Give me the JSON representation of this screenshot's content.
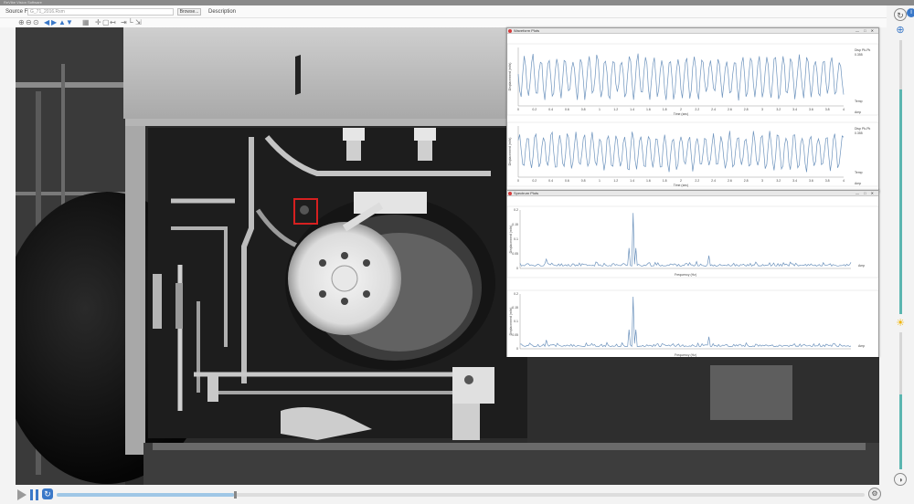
{
  "window": {
    "title": "ReVibe Vision Software"
  },
  "header": {
    "source_label": "Source File",
    "source_value": "G_71_2016.Rsm",
    "browse_label": "Browse...",
    "description_label": "Description"
  },
  "toolbar": {
    "icons": [
      "zoom-in-icon",
      "zoom-out-icon",
      "zoom-fit-icon",
      "arrow-left-icon",
      "arrow-right-icon",
      "arrow-up-icon",
      "arrow-down-icon",
      "grid-icon",
      "crosshair-icon",
      "roi-icon",
      "measure-icon",
      "marker-icon",
      "axes-icon",
      "export-icon"
    ]
  },
  "windows": [
    {
      "title": "Waveform Plots",
      "kind": "waveform"
    },
    {
      "title": "Spectrum Plots",
      "kind": "spectrum"
    }
  ],
  "plots": {
    "waveform": {
      "xlabel": "Time (sec)",
      "ylabel": "Displacement (mils)",
      "side_readout": [
        "Disp Pk-Pk",
        "0.355"
      ],
      "side_readout2": [
        "Disp Pk-Pk",
        "0.355"
      ],
      "right_a": "Temp",
      "right_b": "Amp",
      "xticks": [
        "0",
        "0.2",
        "0.4",
        "0.6",
        "0.8",
        "1",
        "1.2",
        "1.4",
        "1.6",
        "1.8",
        "2",
        "2.2",
        "2.4",
        "2.6",
        "2.8",
        "3",
        "3.2",
        "3.4",
        "3.6",
        "3.8",
        "4"
      ]
    },
    "spectrum": {
      "xlabel": "Frequency (Hz)",
      "ylabel": "Displacement (mils)",
      "right_a": "Amp",
      "yticks": [
        "0.2",
        "0.15",
        "0.1",
        "0.05",
        "0"
      ]
    }
  },
  "controls": {
    "play_label": "Play",
    "progress": 0.22
  },
  "rail": {
    "zoom_level": 0.82,
    "brightness_level": 0.55
  },
  "colors": {
    "accent": "#3a78c8",
    "waveform": "#6d93bd",
    "rail_fill": "#5bb6b0",
    "roi_box": "#d62020"
  }
}
